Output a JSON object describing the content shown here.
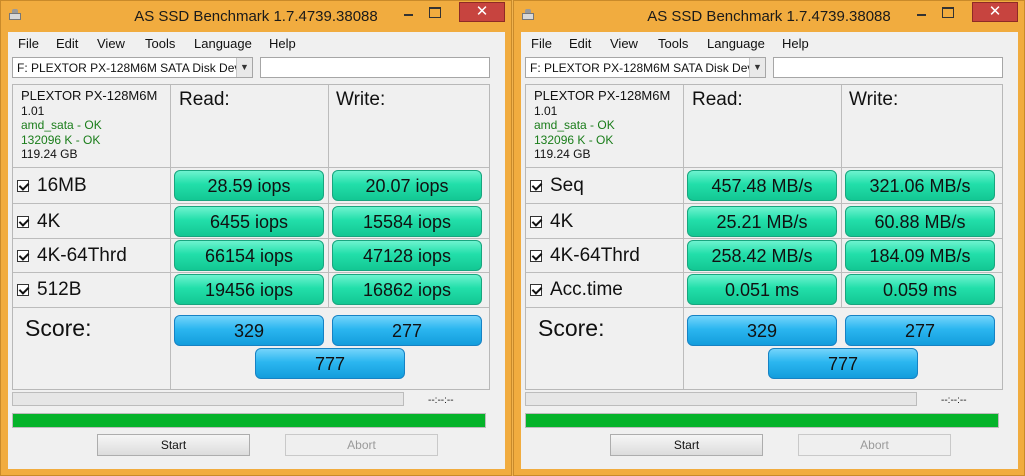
{
  "windows": [
    {
      "title": "AS SSD Benchmark 1.7.4739.38088",
      "menu": [
        "File",
        "Edit",
        "View",
        "Tools",
        "Language",
        "Help"
      ],
      "drive": "F: PLEXTOR PX-128M6M SATA Disk Devi",
      "path_value": "",
      "info": {
        "model": "PLEXTOR PX-128M6M",
        "firmware": "1.01",
        "driver": "amd_sata - OK",
        "alignment": "132096 K - OK",
        "size": "119.24 GB"
      },
      "read_header": "Read:",
      "write_header": "Write:",
      "rows": [
        {
          "label": "16MB",
          "read": "28.59 iops",
          "write": "20.07 iops"
        },
        {
          "label": "4K",
          "read": "6455 iops",
          "write": "15584 iops"
        },
        {
          "label": "4K-64Thrd",
          "read": "66154 iops",
          "write": "47128 iops"
        },
        {
          "label": "512B",
          "read": "19456 iops",
          "write": "16862 iops"
        }
      ],
      "score_label": "Score:",
      "score": {
        "read": "329",
        "write": "277",
        "total": "777"
      },
      "timer": "--:--:--",
      "progress": 1.0,
      "start_label": "Start",
      "abort_label": "Abort"
    },
    {
      "title": "AS SSD Benchmark 1.7.4739.38088",
      "menu": [
        "File",
        "Edit",
        "View",
        "Tools",
        "Language",
        "Help"
      ],
      "drive": "F: PLEXTOR PX-128M6M SATA Disk Devi",
      "path_value": "",
      "info": {
        "model": "PLEXTOR PX-128M6M",
        "firmware": "1.01",
        "driver": "amd_sata - OK",
        "alignment": "132096 K - OK",
        "size": "119.24 GB"
      },
      "read_header": "Read:",
      "write_header": "Write:",
      "rows": [
        {
          "label": "Seq",
          "read": "457.48 MB/s",
          "write": "321.06 MB/s"
        },
        {
          "label": "4K",
          "read": "25.21 MB/s",
          "write": "60.88 MB/s"
        },
        {
          "label": "4K-64Thrd",
          "read": "258.42 MB/s",
          "write": "184.09 MB/s"
        },
        {
          "label": "Acc.time",
          "read": "0.051 ms",
          "write": "0.059 ms"
        }
      ],
      "score_label": "Score:",
      "score": {
        "read": "329",
        "write": "277",
        "total": "777"
      },
      "timer": "--:--:--",
      "progress": 1.0,
      "start_label": "Start",
      "abort_label": "Abort"
    }
  ]
}
